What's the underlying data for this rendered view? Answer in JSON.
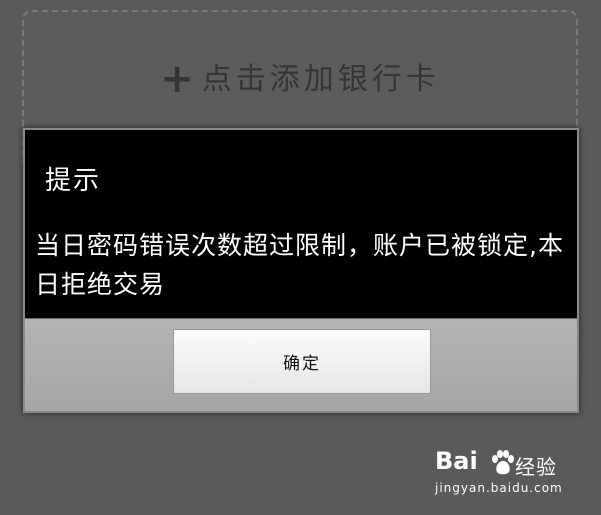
{
  "add_card": {
    "plus_glyph": "+",
    "label": "点击添加银行卡"
  },
  "dialog": {
    "title": "提示",
    "message": "当日密码错误次数超过限制，账户已被锁定,本日拒绝交易",
    "ok_label": "确定"
  },
  "watermark": {
    "logo_left": "Bai",
    "logo_right": "经验",
    "url": "jingyan.baidu.com"
  },
  "colors": {
    "background": "#5a5a5c",
    "dialog_body": "#000000",
    "dialog_footer": "#b0b0b2",
    "button": "#f2f2f2"
  },
  "icons": {
    "add": "plus-icon",
    "watermark": "baidu-paw-icon"
  }
}
